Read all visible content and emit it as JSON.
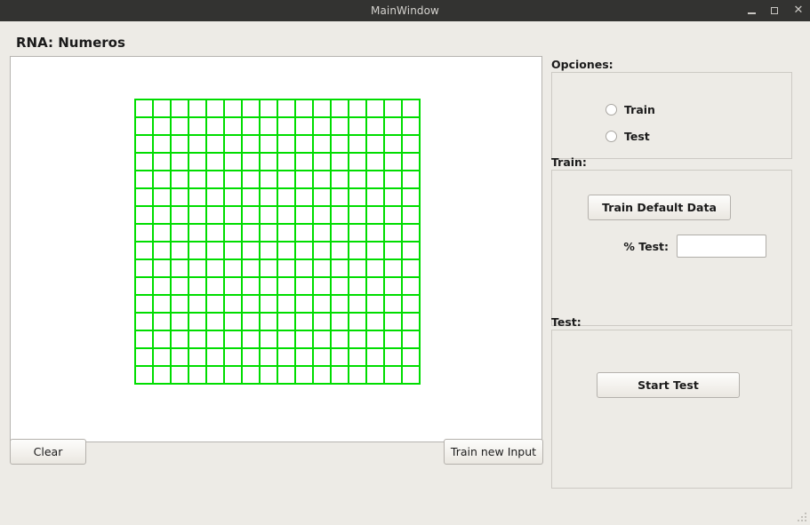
{
  "window": {
    "title": "MainWindow",
    "controls": [
      {
        "name": "minimize",
        "glyph": "_"
      },
      {
        "name": "maximize",
        "glyph": "□"
      },
      {
        "name": "close",
        "glyph": "✕"
      }
    ]
  },
  "page": {
    "title": "RNA: Numeros"
  },
  "canvas": {
    "grid": {
      "rows": 16,
      "cols": 16,
      "cell_size_px": 20,
      "line_color": "#00dd00",
      "background": "#ffffff"
    }
  },
  "bottom_bar": {
    "clear_label": "Clear",
    "train_new_input_label": "Train new Input"
  },
  "options": {
    "section_label": "Opciones:",
    "radios": [
      {
        "label": "Train",
        "checked": false
      },
      {
        "label": "Test",
        "checked": false
      }
    ]
  },
  "train": {
    "section_label": "Train:",
    "train_default_data_label": "Train Default Data",
    "pct_test_label": "% Test:",
    "pct_test_value": "",
    "pct_test_placeholder": ""
  },
  "test": {
    "section_label": "Test:",
    "start_test_label": "Start Test"
  },
  "colors": {
    "titlebar_bg": "#333331",
    "titlebar_fg": "#d5d3cf",
    "window_bg": "#edebe6",
    "grid_green": "#00dd00",
    "border_gray": "#b6b4b0"
  }
}
